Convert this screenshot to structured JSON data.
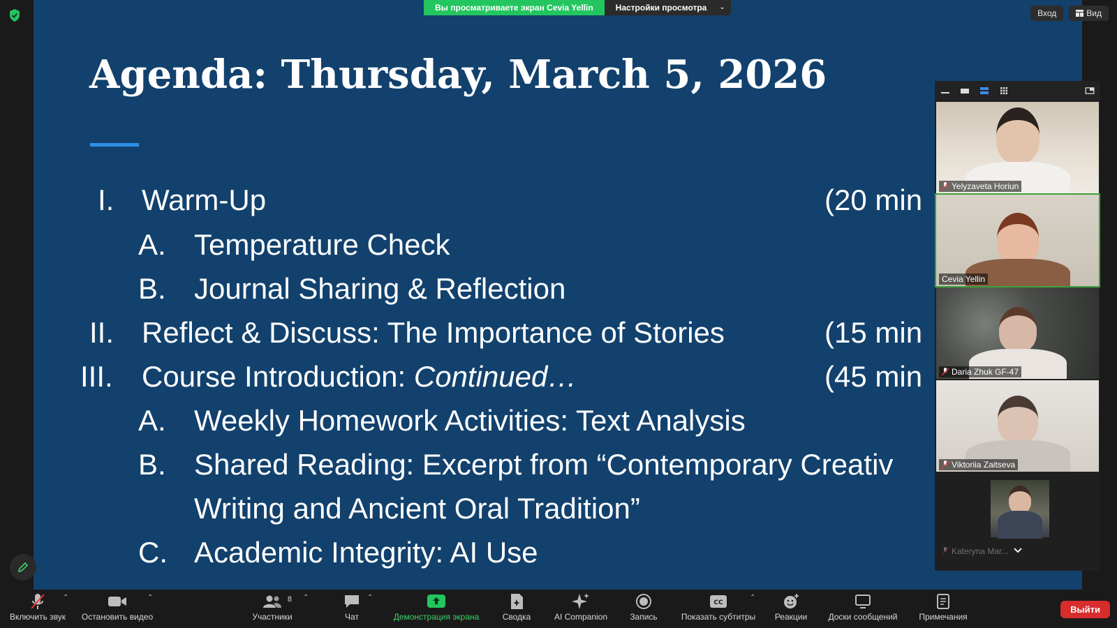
{
  "share_banner": {
    "status": "Вы просматриваете экран Cevia Yellin",
    "view_settings": "Настройки просмотра"
  },
  "top_right": {
    "signin": "Вход",
    "view": "Вид"
  },
  "slide": {
    "title": "Agenda: Thursday, March 5, 2026",
    "items": [
      {
        "num": "I.",
        "text": "Warm-Up",
        "duration": "(20 min"
      },
      {
        "num": "A.",
        "text": "Temperature Check"
      },
      {
        "num": "B.",
        "text": "Journal Sharing & Reflection"
      },
      {
        "num": "II.",
        "text": "Reflect & Discuss: The Importance of Stories",
        "duration": "(15 min"
      },
      {
        "num": "III.",
        "text": "Course Introduction: ",
        "text_italic": "Continued…",
        "duration": "(45 min"
      },
      {
        "num": "A.",
        "text": "Weekly Homework Activities: Text Analysis"
      },
      {
        "num": "B.",
        "text": "Shared Reading: Excerpt from “Contemporary Creativ",
        "text_line2": "Writing and Ancient Oral Tradition”"
      },
      {
        "num": "C.",
        "text": "Academic Integrity: AI Use"
      }
    ]
  },
  "participants": [
    {
      "name": "Yelyzaveta Horiun",
      "muted": true
    },
    {
      "name": "Cevia Yellin",
      "muted": false
    },
    {
      "name": "Daria Zhuk GF-47",
      "muted": true
    },
    {
      "name": "Viktoriia Zaitseva",
      "muted": true
    },
    {
      "name": "Kateryna Mar...",
      "muted": true
    }
  ],
  "toolbar": {
    "unmute": "Включить звук",
    "stop_video": "Остановить видео",
    "participants": "Участники",
    "participants_count": "8",
    "chat": "Чат",
    "share_screen": "Демонстрация экрана",
    "summary": "Сводка",
    "ai_companion": "AI Companion",
    "record": "Запись",
    "captions": "Показать субтитры",
    "reactions": "Реакции",
    "whiteboards": "Доски сообщений",
    "notes": "Примечания",
    "leave": "Выйти"
  },
  "colors": {
    "slide_bg": "#12416d",
    "accent_line": "#2f8fe6",
    "share_green": "#23c55e",
    "leave_red": "#d72d2d"
  }
}
